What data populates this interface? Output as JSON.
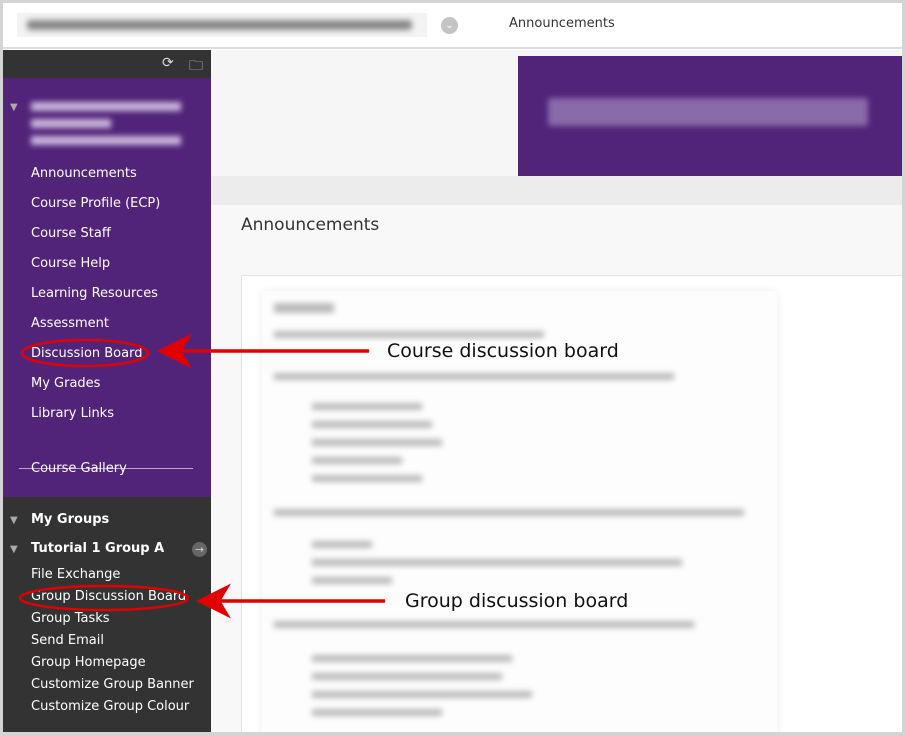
{
  "topbar": {
    "breadcrumb": "Announcements"
  },
  "sidebar": {
    "course_menu": [
      "Announcements",
      "Course Profile (ECP)",
      "Course Staff",
      "Course Help",
      "Learning Resources",
      "Assessment",
      "Discussion Board",
      "My Grades",
      "Library Links"
    ],
    "gallery": "Course Gallery",
    "my_groups": "My Groups",
    "group_name": "Tutorial 1 Group A",
    "group_tools": [
      "File Exchange",
      "Group Discussion Board",
      "Group Tasks",
      "Send Email",
      "Group Homepage",
      "Customize Group Banner",
      "Customize Group Colour"
    ]
  },
  "main": {
    "page_title": "Announcements"
  },
  "annotations": {
    "course": "Course discussion board",
    "group": "Group discussion board"
  },
  "colors": {
    "purple": "#512479",
    "dark": "#333333",
    "annotation": "#e00000"
  }
}
